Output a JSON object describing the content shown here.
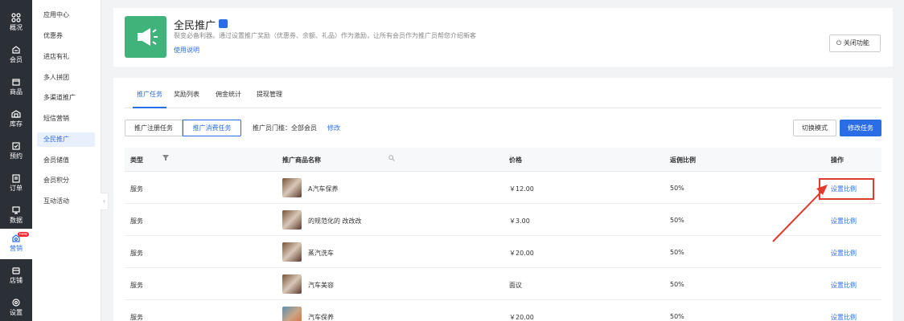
{
  "rail": {
    "items": [
      {
        "label": "概况",
        "icon": "dashboard-icon"
      },
      {
        "label": "会员",
        "icon": "member-icon"
      },
      {
        "label": "商品",
        "icon": "goods-icon"
      },
      {
        "label": "库存",
        "icon": "stock-icon"
      },
      {
        "label": "预约",
        "icon": "booking-icon"
      },
      {
        "label": "订单",
        "icon": "order-icon"
      },
      {
        "label": "数据",
        "icon": "data-icon"
      },
      {
        "label": "营销",
        "icon": "marketing-icon",
        "badge": "new"
      },
      {
        "label": "店铺",
        "icon": "store-icon"
      },
      {
        "label": "设置",
        "icon": "settings-icon"
      }
    ]
  },
  "subnav": {
    "items": [
      "应用中心",
      "优惠券",
      "进店有礼",
      "多人拼团",
      "多渠道推广",
      "短信营销",
      "全民推广",
      "会员储值",
      "会员积分",
      "互动活动"
    ],
    "active": "全民推广"
  },
  "header": {
    "title": "全民推广",
    "description": "裂变必备利器。通过设置推广奖励（优惠券、余额、礼品）作为激励，让所有会员作为推广员帮您介绍新客",
    "help_link": "使用说明",
    "close_button": "关闭功能"
  },
  "tabs": [
    "推广任务",
    "奖励列表",
    "佣金统计",
    "提现管理"
  ],
  "task_switch": [
    "推广注册任务",
    "推广消费任务"
  ],
  "threshold_text": "推广员门槛：全部会员",
  "threshold_edit": "修改",
  "switch_mode_button": "切换模式",
  "edit_task_button": "修改任务",
  "table": {
    "headers": [
      "类型",
      "推广商品名称",
      "价格",
      "返佣比例",
      "操作"
    ],
    "rows": [
      {
        "type": "服务",
        "name": "A汽车保养",
        "price": "￥12.00",
        "ratio": "50%",
        "action": "设置比例"
      },
      {
        "type": "服务",
        "name": "的规范化的 改改改",
        "price": "￥3.00",
        "ratio": "50%",
        "action": "设置比例"
      },
      {
        "type": "服务",
        "name": "蒸汽洗车",
        "price": "￥20.00",
        "ratio": "50%",
        "action": "设置比例"
      },
      {
        "type": "服务",
        "name": "汽车美容",
        "price": "面议",
        "ratio": "50%",
        "action": "设置比例"
      },
      {
        "type": "服务",
        "name": "汽车保养",
        "price": "￥20.00",
        "ratio": "50%",
        "action": "设置比例"
      }
    ]
  },
  "colors": {
    "primary": "#2b6de5",
    "rail_bg": "#2b2f36",
    "logo_green": "#3fb37a",
    "annotation_red": "#e23a2e"
  }
}
